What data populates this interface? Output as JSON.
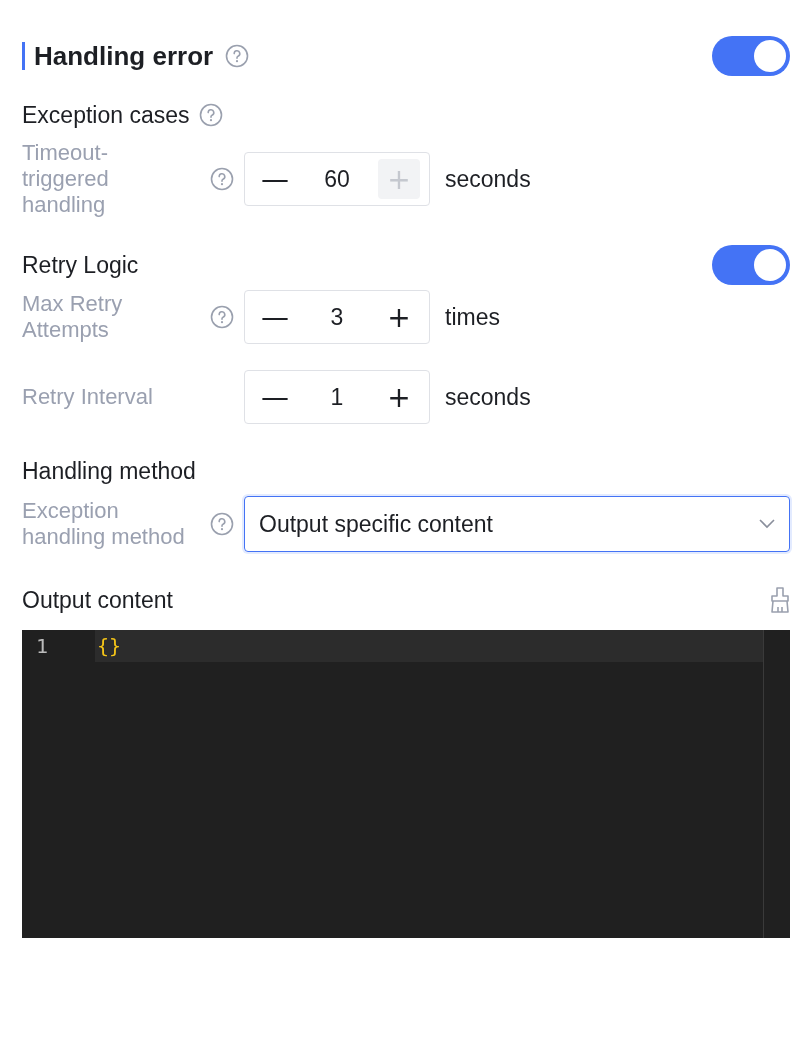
{
  "header": {
    "title": "Handling error",
    "on": true
  },
  "groups": [
    {
      "title": "Exception cases",
      "help": true,
      "fields": [
        {
          "kind": "stepper",
          "label": "Timeout-triggered handling",
          "help": true,
          "value": "60",
          "unit": "seconds",
          "minus": "—",
          "plus": "+",
          "plus_disabled": true
        }
      ]
    },
    {
      "title": "Retry Logic",
      "help": false,
      "toggle": {
        "on": true
      },
      "fields": [
        {
          "kind": "stepper",
          "label": "Max Retry Attempts",
          "help": true,
          "value": "3",
          "unit": "times",
          "minus": "—",
          "plus": "+",
          "plus_disabled": false
        },
        {
          "kind": "stepper",
          "label": "Retry Interval",
          "help": false,
          "value": "1",
          "unit": "seconds",
          "minus": "—",
          "plus": "+",
          "plus_disabled": false
        }
      ]
    },
    {
      "title": "Handling method",
      "help": false,
      "fields": [
        {
          "kind": "select",
          "label": "Exception handling method",
          "help": true,
          "value": "Output specific content"
        }
      ]
    }
  ],
  "output": {
    "title": "Output content",
    "lines": [
      {
        "number": "1",
        "code": "{}"
      }
    ]
  }
}
